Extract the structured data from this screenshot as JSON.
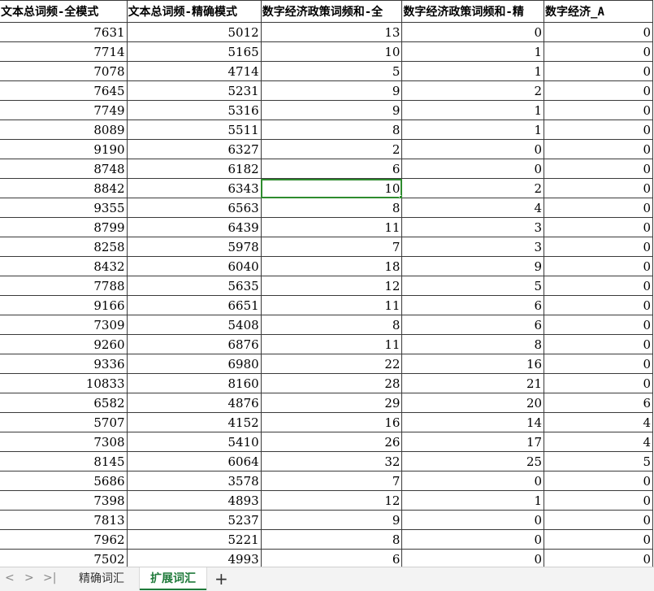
{
  "headers": [
    "文本总词频-全模式",
    "文本总词频-精确模式",
    "数字经济政策词频和-全",
    "数字经济政策词频和-精",
    "数字经济_A"
  ],
  "rows": [
    [
      "7631",
      "5012",
      "13",
      "0",
      "0"
    ],
    [
      "7714",
      "5165",
      "10",
      "1",
      "0"
    ],
    [
      "7078",
      "4714",
      "5",
      "1",
      "0"
    ],
    [
      "7645",
      "5231",
      "9",
      "2",
      "0"
    ],
    [
      "7749",
      "5316",
      "9",
      "1",
      "0"
    ],
    [
      "8089",
      "5511",
      "8",
      "1",
      "0"
    ],
    [
      "9190",
      "6327",
      "2",
      "0",
      "0"
    ],
    [
      "8748",
      "6182",
      "6",
      "0",
      "0"
    ],
    [
      "8842",
      "6343",
      "10",
      "2",
      "0"
    ],
    [
      "9355",
      "6563",
      "8",
      "4",
      "0"
    ],
    [
      "8799",
      "6439",
      "11",
      "3",
      "0"
    ],
    [
      "8258",
      "5978",
      "7",
      "3",
      "0"
    ],
    [
      "8432",
      "6040",
      "18",
      "9",
      "0"
    ],
    [
      "7788",
      "5635",
      "12",
      "5",
      "0"
    ],
    [
      "9166",
      "6651",
      "11",
      "6",
      "0"
    ],
    [
      "7309",
      "5408",
      "8",
      "6",
      "0"
    ],
    [
      "9260",
      "6876",
      "11",
      "8",
      "0"
    ],
    [
      "9336",
      "6980",
      "22",
      "16",
      "0"
    ],
    [
      "10833",
      "8160",
      "28",
      "21",
      "0"
    ],
    [
      "6582",
      "4876",
      "29",
      "20",
      "6"
    ],
    [
      "5707",
      "4152",
      "16",
      "14",
      "4"
    ],
    [
      "7308",
      "5410",
      "26",
      "17",
      "4"
    ],
    [
      "8145",
      "6064",
      "32",
      "25",
      "5"
    ],
    [
      "5686",
      "3578",
      "7",
      "0",
      "0"
    ],
    [
      "7398",
      "4893",
      "12",
      "1",
      "0"
    ],
    [
      "7813",
      "5237",
      "9",
      "0",
      "0"
    ],
    [
      "7962",
      "5221",
      "8",
      "0",
      "0"
    ],
    [
      "7502",
      "4993",
      "6",
      "0",
      "0"
    ]
  ],
  "selected": {
    "row": 8,
    "col": 2
  },
  "tabs": {
    "nav_prev": "<",
    "nav_next": ">",
    "nav_last": ">|",
    "sheets": [
      "精确词汇",
      "扩展词汇"
    ],
    "active_index": 1,
    "add": "+"
  },
  "colors": {
    "selection": "#2e8b2e",
    "active_tab": "#1f7a3a"
  }
}
